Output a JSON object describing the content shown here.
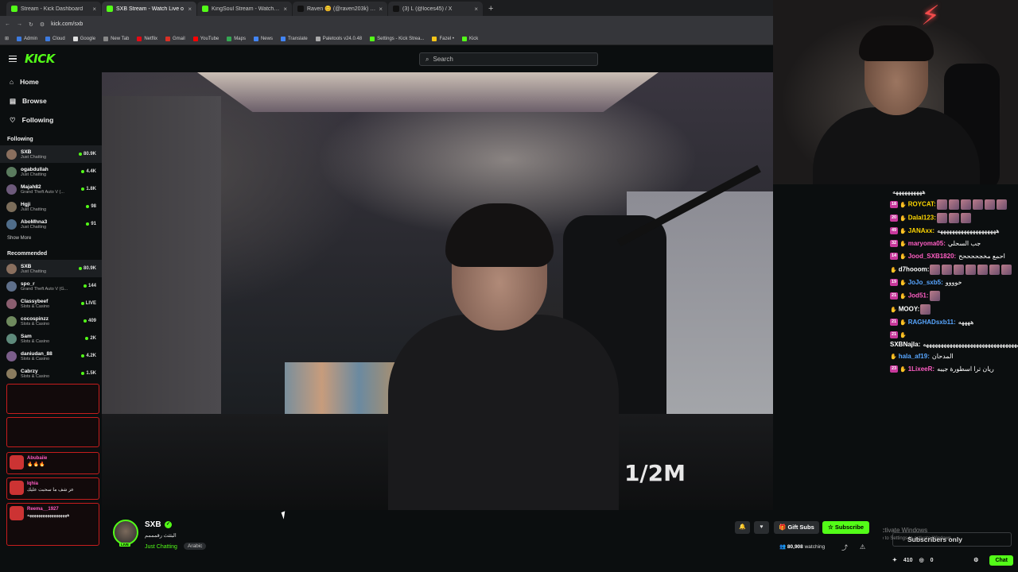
{
  "browser": {
    "tabs": [
      {
        "label": "Stream - Kick Dashboard",
        "color": "#53fc18",
        "active": false
      },
      {
        "label": "SXB Stream - Watch Live o",
        "color": "#53fc18",
        "active": true
      },
      {
        "label": "KingSoul Stream - Watch Live",
        "color": "#53fc18",
        "active": false
      },
      {
        "label": "Raven 😊 (@raven203k) | TikTo",
        "color": "#111111",
        "active": false
      },
      {
        "label": "(3) L (@loces45) / X",
        "color": "#111111",
        "active": false
      }
    ],
    "url": "kick.com/sxb",
    "bookmarks": [
      {
        "label": "Admin",
        "color": "#3d7be0"
      },
      {
        "label": "Cloud",
        "color": "#3d7be0"
      },
      {
        "label": "Google",
        "color": "#e0e0e0"
      },
      {
        "label": "New Tab",
        "color": "#888888"
      },
      {
        "label": "Netflix",
        "color": "#e50914"
      },
      {
        "label": "Gmail",
        "color": "#d93025"
      },
      {
        "label": "YouTube",
        "color": "#ff0000"
      },
      {
        "label": "Maps",
        "color": "#34a853"
      },
      {
        "label": "News",
        "color": "#4285f4"
      },
      {
        "label": "Translate",
        "color": "#4285f4"
      },
      {
        "label": "Paletools v24.0.48",
        "color": "#aaaaaa"
      },
      {
        "label": "Settings - Kick Strea...",
        "color": "#53fc18"
      },
      {
        "label": "Fazel •",
        "color": "#f5c518"
      },
      {
        "label": "Kick",
        "color": "#53fc18"
      }
    ]
  },
  "header": {
    "logo": "KICK",
    "search_placeholder": "Search"
  },
  "sidebar": {
    "nav": [
      {
        "label": "Home",
        "icon": "home-icon"
      },
      {
        "label": "Browse",
        "icon": "browse-icon"
      },
      {
        "label": "Following",
        "icon": "heart-icon"
      }
    ],
    "following_title": "Following",
    "following": [
      {
        "name": "SXB",
        "category": "Just Chatting",
        "viewers": "80.9K",
        "color": "#8a6f5e"
      },
      {
        "name": "ogabdullah",
        "category": "Just Chatting",
        "viewers": "4.4K",
        "color": "#5a7b5e"
      },
      {
        "name": "Majah82",
        "category": "Grand Theft Auto V (...",
        "viewers": "1.8K",
        "color": "#6d5a7b"
      },
      {
        "name": "Hgji",
        "category": "Just Chatting",
        "viewers": "98",
        "color": "#7b6d5a"
      },
      {
        "name": "AboMhna3",
        "category": "Just Chatting",
        "viewers": "91",
        "color": "#4f6d8a"
      }
    ],
    "show_more": "Show More",
    "recommended_title": "Recommended",
    "recommended": [
      {
        "name": "SXB",
        "category": "Just Chatting",
        "viewers": "80.9K",
        "color": "#8a6f5e"
      },
      {
        "name": "spo_r",
        "category": "Grand Theft Auto V (G...",
        "viewers": "144",
        "color": "#5e6f8a"
      },
      {
        "name": "Classybeef",
        "category": "Slots & Casino",
        "viewers": "LIVE",
        "color": "#8a5e6f"
      },
      {
        "name": "cocospinzz",
        "category": "Slots & Casino",
        "viewers": "409",
        "color": "#6f8a5e"
      },
      {
        "name": "Sam",
        "category": "Slots & Casino",
        "viewers": "2K",
        "color": "#5e8a7b"
      },
      {
        "name": "daniudan_88",
        "category": "Slots & Casino",
        "viewers": "4.2K",
        "color": "#7b5e8a"
      },
      {
        "name": "Cabrzy",
        "category": "Slots & Casino",
        "viewers": "1.5K",
        "color": "#8a7b5e"
      }
    ],
    "overlay_chat": [
      {
        "name": "Abubaiie",
        "text": "🔥🔥🔥"
      },
      {
        "name": "Iqhia",
        "text": "عز شف ما سحبت عليك"
      },
      {
        "name": "Reema__1927",
        "text": "ههههههههههههههههههه"
      }
    ]
  },
  "video": {
    "watermark": "1/2M"
  },
  "chat": {
    "messages": [
      {
        "badge": "",
        "user": "",
        "color": "#ffffff",
        "text": "ههههههههههه",
        "emotes": 0
      },
      {
        "badge": "18",
        "user": "ROYCAT:",
        "color": "#ffd700",
        "text": "",
        "emotes": 6
      },
      {
        "badge": "20",
        "user": "Dalal123:",
        "color": "#ffd700",
        "text": "",
        "emotes": 3
      },
      {
        "badge": "49",
        "user": "JANAxx:",
        "color": "#ffd700",
        "text": "ههههههههههههههههههههه",
        "emotes": 0
      },
      {
        "badge": "32",
        "user": "maryoma05:",
        "color": "#ff5ec4",
        "text": "جب السحلي",
        "emotes": 0
      },
      {
        "badge": "14",
        "user": "Jood_SXB1820:",
        "color": "#ff5ec4",
        "text": "احمع مخجححححح",
        "emotes": 0
      },
      {
        "badge": "",
        "user": "d7hooom:",
        "color": "#ffffff",
        "text": "",
        "emotes": 7
      },
      {
        "badge": "19",
        "user": "JoJo_sxb5:",
        "color": "#58a6ff",
        "text": "خوووو",
        "emotes": 0
      },
      {
        "badge": "21",
        "user": "Jod51:",
        "color": "#ff5ec4",
        "text": "",
        "emotes": 1
      },
      {
        "badge": "",
        "user": "MOOY:",
        "color": "#ffffff",
        "text": "",
        "emotes": 1
      },
      {
        "badge": "21",
        "user": "RAGHADsxb11:",
        "color": "#58a6ff",
        "text": "ههههه",
        "emotes": 0
      },
      {
        "badge": "21",
        "user": "SXBNajla:",
        "color": "#ffffff",
        "text": "هههههههههههههههههههههههههههههههههههههههههههه",
        "emotes": 0
      },
      {
        "badge": "",
        "user": "hala_af19:",
        "color": "#58a6ff",
        "text": "المدحان",
        "emotes": 0
      },
      {
        "badge": "23",
        "user": "1LixeeR:",
        "color": "#ff5ec4",
        "text": "ريان ترا اسطورة جيبه",
        "emotes": 0
      }
    ],
    "input_placeholder": "Subscribers only",
    "points": "410",
    "count": "0",
    "send_label": "Chat"
  },
  "activate_windows": {
    "title": "Activate Windows",
    "subtitle": "Go to Settings to activate Windows."
  },
  "channel": {
    "name": "SXB",
    "title": "البثثث رقمممم",
    "category": "Just Chatting",
    "tag": "Arabic",
    "live_label": "LIVE",
    "gift_label": "Gift Subs",
    "subscribe_label": "Subscribe",
    "watching": "80,908",
    "watching_suffix": "watching"
  },
  "colors": {
    "brand": "#53fc18",
    "background": "#0b0e0f"
  }
}
